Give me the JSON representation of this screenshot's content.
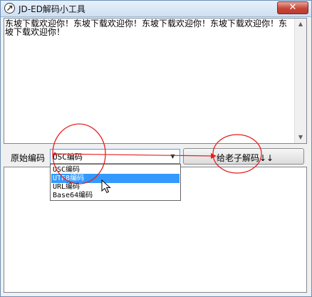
{
  "window": {
    "title": "JD-ED解码小工具",
    "close_glyph": "✕"
  },
  "input_text": "东坡下载欢迎你！东坡下载欢迎你！东坡下载欢迎你！东坡下载欢迎你！东坡下载欢迎你！",
  "controls": {
    "encoding_label": "原始编码",
    "encoding_value": "USC编码",
    "decode_button": "给老子解码↓↓"
  },
  "dropdown": {
    "options": [
      "USC编码",
      "UTF8编码",
      "URL编码",
      "Base64编码"
    ],
    "highlighted_index": 1
  },
  "colors": {
    "annotation": "#e81e1e",
    "highlight": "#3399ff"
  }
}
